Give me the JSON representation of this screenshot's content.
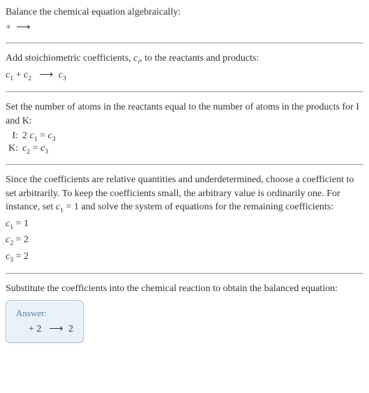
{
  "section1": {
    "line1": "Balance the chemical equation algebraically:",
    "line2_pre": " + ",
    "arrow": "⟶"
  },
  "section2": {
    "line1": "Add stoichiometric coefficients, ",
    "ci": "c",
    "ci_sub": "i",
    "line1_after": ", to the reactants and products:",
    "eq_c1": "c",
    "eq_c1_sub": "1",
    "eq_plus": " + ",
    "eq_c2": "c",
    "eq_c2_sub": "2",
    "arrow": "⟶",
    "eq_c3": "c",
    "eq_c3_sub": "3"
  },
  "section3": {
    "line1": "Set the number of atoms in the reactants equal to the number of atoms in the products for I and K:",
    "row1_label": "I:",
    "row1_lhs_coef": "2 ",
    "row1_c1": "c",
    "row1_c1_sub": "1",
    "row1_eq": " = ",
    "row1_c3": "c",
    "row1_c3_sub": "3",
    "row2_label": "K:",
    "row2_c2": "c",
    "row2_c2_sub": "2",
    "row2_eq": " = ",
    "row2_c3": "c",
    "row2_c3_sub": "3"
  },
  "section4": {
    "line1_a": "Since the coefficients are relative quantities and underdetermined, choose a coefficient to set arbitrarily. To keep the coefficients small, the arbitrary value is ordinarily one. For instance, set ",
    "c1": "c",
    "c1_sub": "1",
    "line1_b": " = 1 and solve the system of equations for the remaining coefficients:",
    "r1_c": "c",
    "r1_sub": "1",
    "r1_val": " = 1",
    "r2_c": "c",
    "r2_sub": "2",
    "r2_val": " = 2",
    "r3_c": "c",
    "r3_sub": "3",
    "r3_val": " = 2"
  },
  "section5": {
    "line1": "Substitute the coefficients into the chemical reaction to obtain the balanced equation:"
  },
  "answer": {
    "label": "Answer:",
    "pre": " + 2 ",
    "arrow": "⟶",
    "post": " 2 "
  }
}
